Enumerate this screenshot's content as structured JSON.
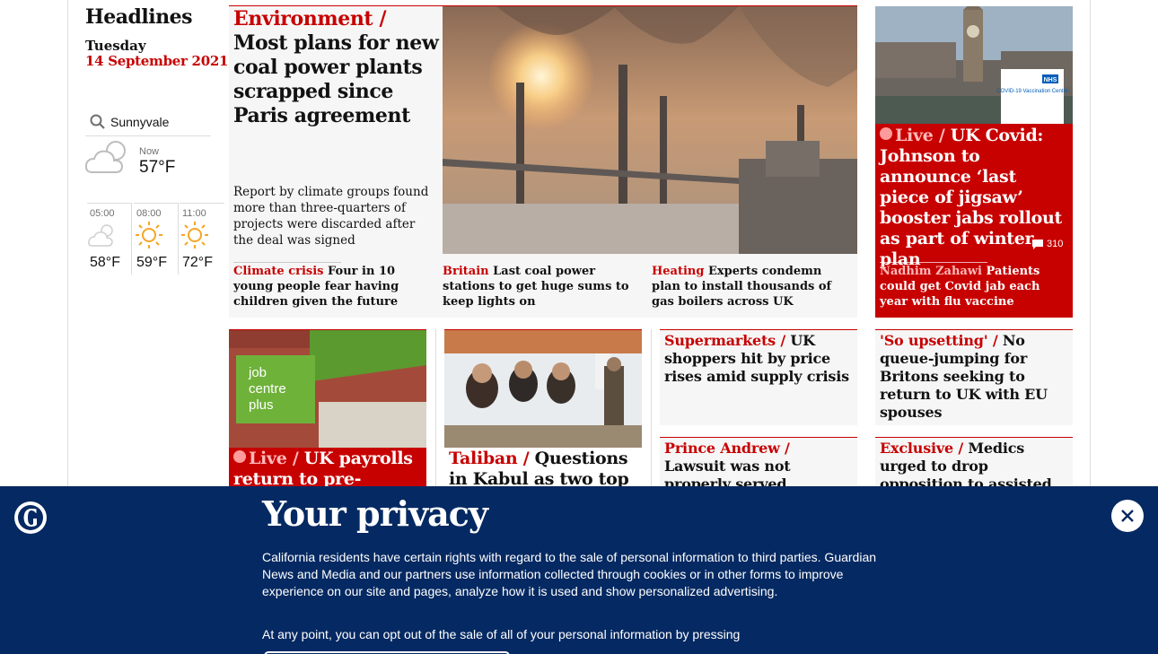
{
  "sidebar": {
    "title": "Headlines",
    "day": "Tuesday",
    "date": "14 September 2021",
    "location": "Sunnyvale",
    "now_label": "Now",
    "now_temp": "57°F",
    "forecast": [
      {
        "time": "05:00",
        "temp": "58°F",
        "icon": "cloud-sun-icon"
      },
      {
        "time": "08:00",
        "temp": "59°F",
        "icon": "sun-icon"
      },
      {
        "time": "11:00",
        "temp": "72°F",
        "icon": "sun-icon"
      }
    ]
  },
  "main_story": {
    "kicker": "Environment /",
    "headline": "Most plans for new coal power plants scrapped since Paris agreement",
    "standfirst": "Report by climate groups found more than three-quarters of projects were discarded after the deal was signed",
    "sublinks": [
      {
        "kicker": "Climate crisis",
        "text": "Four in 10 young people fear having children given the future"
      },
      {
        "kicker": "Britain",
        "text": "Last coal power stations to get huge sums to keep lights on"
      },
      {
        "kicker": "Heating",
        "text": "Experts condemn plan to install thousands of gas boilers across UK"
      }
    ]
  },
  "covid_story": {
    "kicker": "Live /",
    "headline": "UK Covid: Johnson to announce ‘last piece of jigsaw’ booster jabs rollout as part of winter plan",
    "comments": "310",
    "sub_kicker": "Nadhim Zahawi",
    "sub_text": "Patients could get Covid jab each year with flu vaccine",
    "sign_top": "NHS",
    "sign_text": "COVID-19 Vaccination Centre"
  },
  "row2": {
    "payrolls": {
      "kicker": "Live /",
      "headline": "UK payrolls return to pre-"
    },
    "taliban": {
      "kicker": "Taliban /",
      "headline": "Questions in Kabul as two top"
    },
    "supermarkets": {
      "kicker": "Supermarkets /",
      "headline": "UK shoppers hit by price rises amid supply crisis"
    },
    "upsetting": {
      "kicker": "'So upsetting' /",
      "headline": "No queue-jumping for Britons seeking to return to UK with EU spouses"
    },
    "prince": {
      "kicker": "Prince Andrew /",
      "headline": "Lawsuit was not properly served, lawyers argue"
    },
    "exclusive": {
      "kicker": "Exclusive /",
      "headline": "Medics urged to drop opposition to assisted dying before"
    },
    "jobcentre_sign": [
      "job",
      "centre",
      "plus"
    ]
  },
  "privacy": {
    "title": "Your privacy",
    "body": "California residents have certain rights with regard to the sale of personal information to third parties. Guardian News and Media and our partners use information collected through cookies or in other forms to improve experience on our site and pages, analyze how it is used and show personalized advertising.",
    "body2": "At any point, you can opt out of the sale of all of your personal information by pressing"
  },
  "colors": {
    "accent": "#c70000",
    "brand": "#052962",
    "card": "#f6f6f6"
  }
}
